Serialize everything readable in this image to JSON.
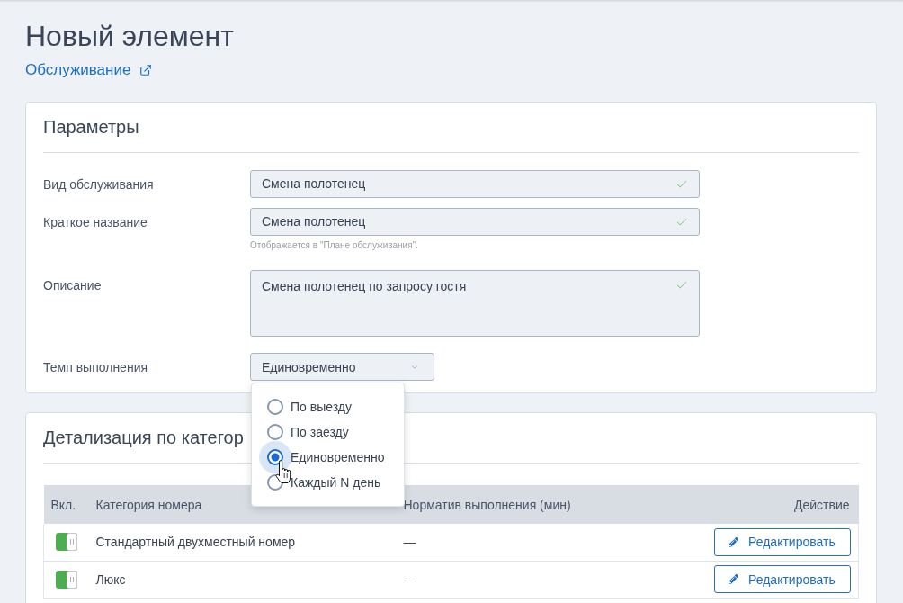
{
  "page": {
    "title": "Новый элемент",
    "link": "Обслуживание"
  },
  "parameters": {
    "title": "Параметры",
    "fields": [
      {
        "kind": "input",
        "label": "Вид обслуживания",
        "value": "Смена полотенец",
        "valid": true
      },
      {
        "kind": "input",
        "label": "Краткое название",
        "value": "Смена полотенец",
        "valid": true,
        "hint": "Отображается в \"Плане обслуживания\"."
      },
      {
        "kind": "textarea",
        "label": "Описание",
        "value": "Смена полотенец по запросу гостя",
        "valid": true
      },
      {
        "kind": "select",
        "label": "Темп выполнения",
        "value": "Единовременно",
        "expanded": true,
        "options": [
          {
            "label": "По выезду",
            "selected": false
          },
          {
            "label": "По заезду",
            "selected": false
          },
          {
            "label": "Единовременно",
            "selected": true
          },
          {
            "label": "Каждый N день",
            "selected": false
          }
        ]
      }
    ]
  },
  "categories": {
    "title": "Детализация по категор",
    "table": {
      "columns": [
        "Вкл.",
        "Категория номера",
        "Норматив выполнения (мин)",
        "Действие"
      ],
      "rows": [
        {
          "enabled": true,
          "category": "Стандартный двухместный номер",
          "norm": "—",
          "action": "Редактировать"
        },
        {
          "enabled": true,
          "category": "Люкс",
          "norm": "—",
          "action": "Редактировать"
        }
      ]
    }
  }
}
